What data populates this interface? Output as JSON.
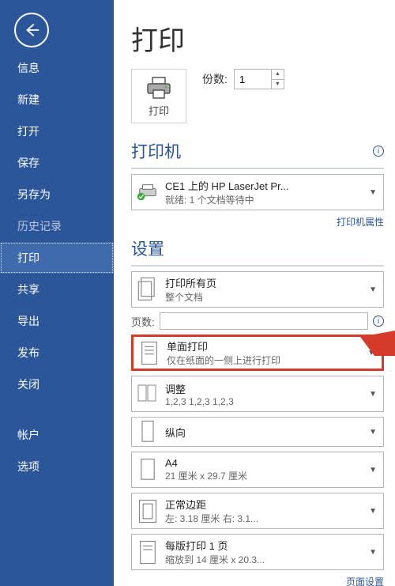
{
  "sidebar": {
    "items": [
      {
        "label": "信息"
      },
      {
        "label": "新建"
      },
      {
        "label": "打开"
      },
      {
        "label": "保存"
      },
      {
        "label": "另存为"
      },
      {
        "label": "历史记录",
        "dim": true
      },
      {
        "label": "打印",
        "active": true
      },
      {
        "label": "共享"
      },
      {
        "label": "导出"
      },
      {
        "label": "发布"
      },
      {
        "label": "关闭"
      }
    ],
    "bottom": [
      {
        "label": "帐户"
      },
      {
        "label": "选项"
      }
    ]
  },
  "main": {
    "title": "打印",
    "printButton": "打印",
    "copiesLabel": "份数:",
    "copiesValue": "1",
    "printerSection": "打印机",
    "printer": {
      "name": "CE1 上的 HP LaserJet Pr...",
      "status": "就绪: 1 个文档等待中"
    },
    "printerPropsLink": "打印机属性",
    "settingsSection": "设置",
    "pagesLabel": "页数:",
    "pagesValue": "",
    "opts": {
      "scope": {
        "t1": "打印所有页",
        "t2": "整个文档"
      },
      "sides": {
        "t1": "单面打印",
        "t2": "仅在纸面的一侧上进行打印"
      },
      "collate": {
        "t1": "调整",
        "t2": "1,2,3    1,2,3    1,2,3"
      },
      "orient": {
        "t1": "纵向"
      },
      "paper": {
        "t1": "A4",
        "t2": "21 厘米 x 29.7 厘米"
      },
      "margins": {
        "t1": "正常边距",
        "t2": "左: 3.18 厘米   右: 3.1..."
      },
      "perSheet": {
        "t1": "每版打印 1 页",
        "t2": "缩放到 14 厘米 x 20.3..."
      }
    },
    "pageSetupLink": "页面设置"
  }
}
